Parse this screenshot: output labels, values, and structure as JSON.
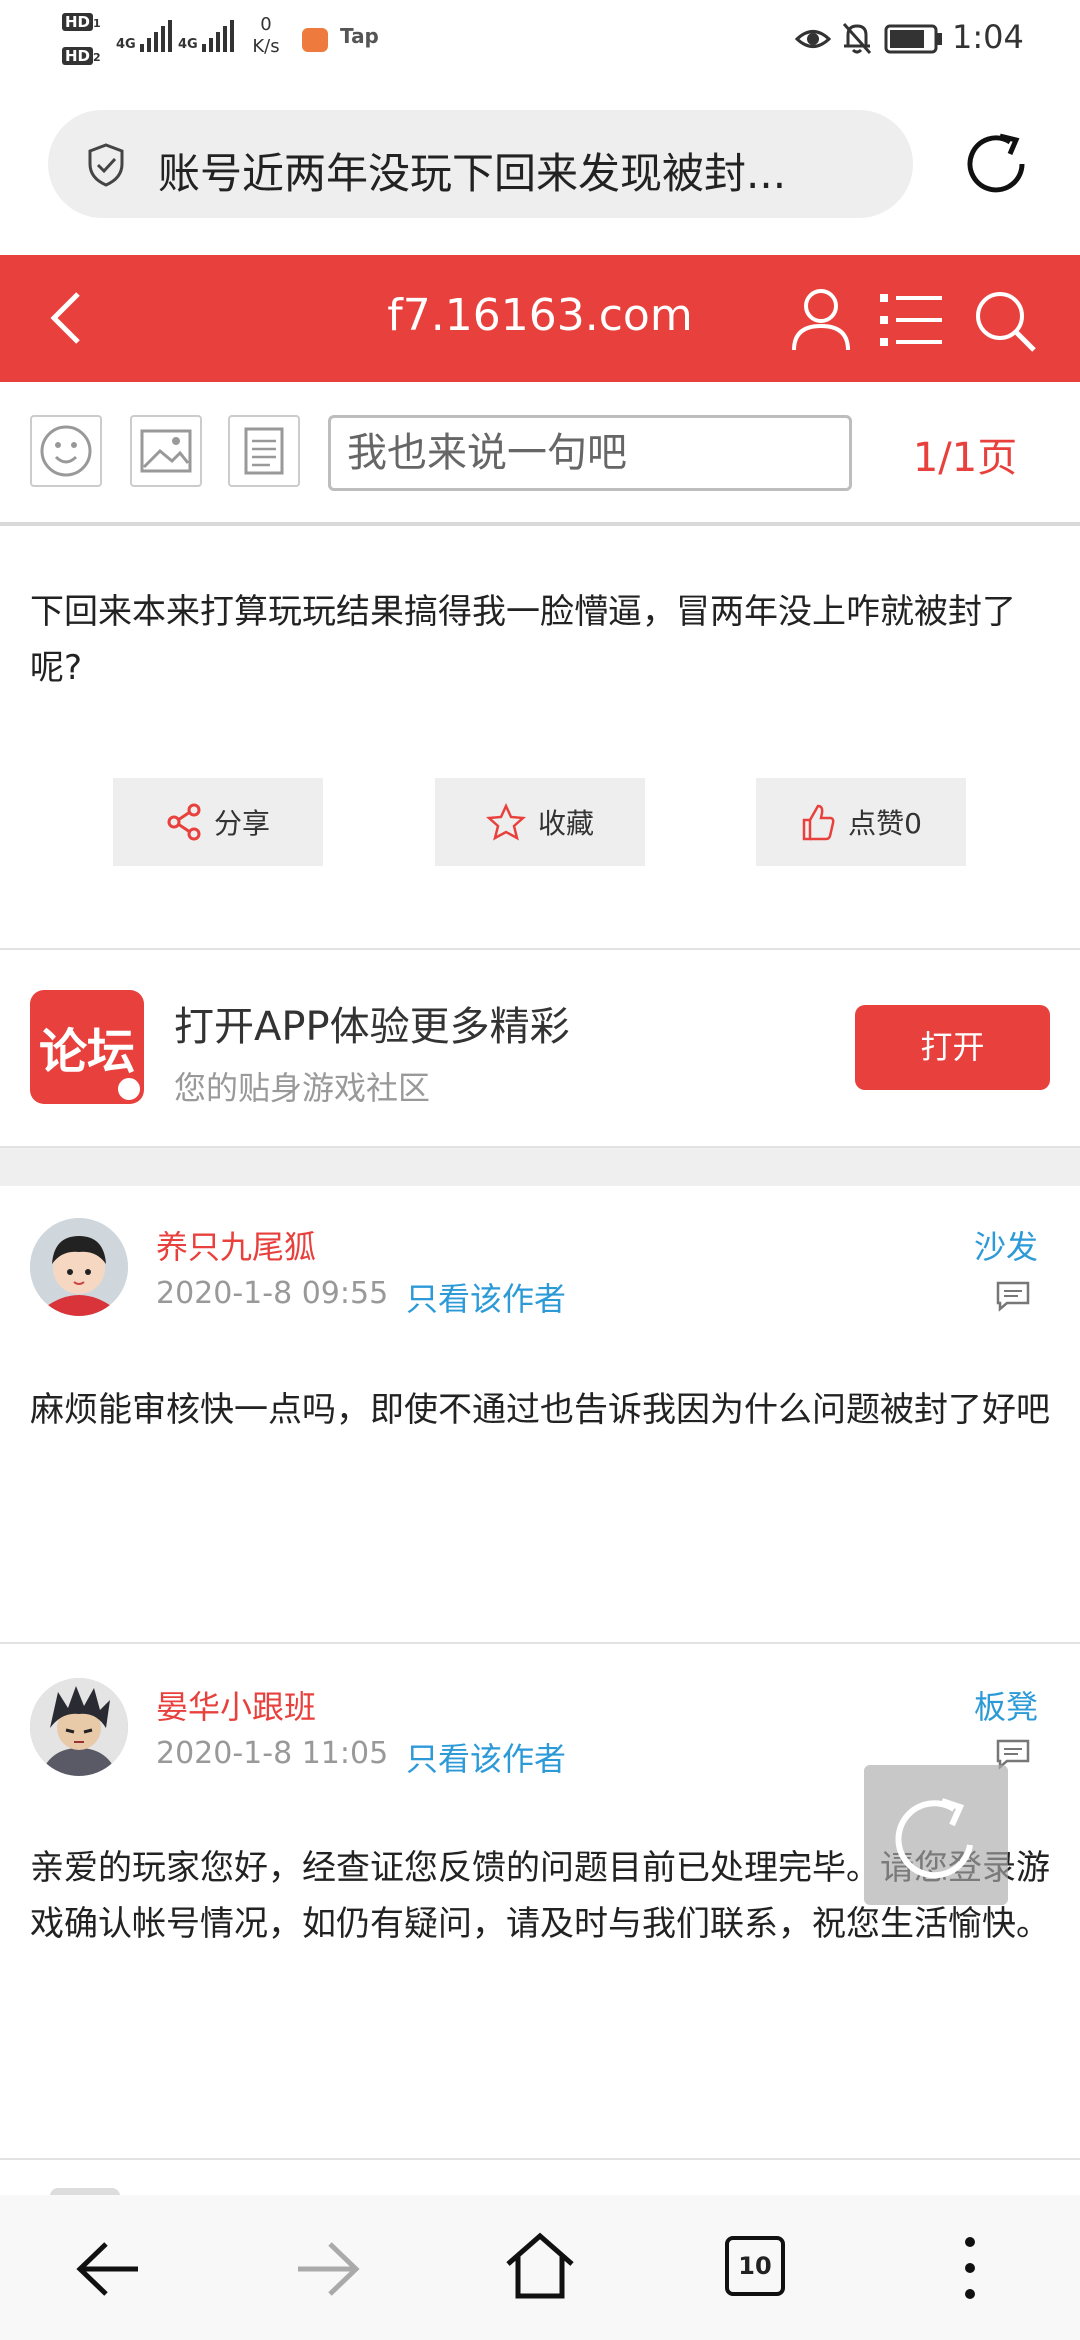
{
  "status_bar": {
    "hd1": "HD",
    "hd1_sub": "1",
    "hd2": "HD",
    "hd2_sub": "2",
    "network1": "4G",
    "network2": "4G",
    "net_speed_value": "0",
    "net_speed_unit": "K/s",
    "app_label": "Tap",
    "time": "1:04"
  },
  "address_bar": {
    "title": "账号近两年没玩下回来发现被封..."
  },
  "header": {
    "domain": "f7.16163.com"
  },
  "toolbar": {
    "reply_placeholder": "我也来说一句吧",
    "pager": "1/1页"
  },
  "main_post": {
    "text": "下回来本来打算玩玩结果搞得我一脸懵逼，冒两年没上咋就被封了呢?",
    "actions": {
      "share": "分享",
      "favorite": "收藏",
      "like": "点赞0"
    }
  },
  "app_banner": {
    "logo_text": "论坛",
    "title": "打开APP体验更多精彩",
    "subtitle": "您的贴身游戏社区",
    "open_button": "打开"
  },
  "replies": [
    {
      "username": "养只九尾狐",
      "date": "2020-1-8 09:55",
      "only_author": "只看该作者",
      "floor": "沙发",
      "text": "麻烦能审核快一点吗，即使不通过也告诉我因为什么问题被封了好吧"
    },
    {
      "username": "晏华小跟班",
      "date": "2020-1-8 11:05",
      "only_author": "只看该作者",
      "floor": "板凳",
      "text": "亲爱的玩家您好，经查证您反馈的问题目前已处理完毕。请您登录游戏确认帐号情况，如仍有疑问，请及时与我们联系，祝您生活愉快。"
    }
  ],
  "bottom_nav": {
    "tabs_count": "10"
  },
  "colors": {
    "brand_red": "#e8413d",
    "link_blue": "#2d9ad8",
    "muted_gray": "#999999"
  },
  "icons": {
    "address_bar": "shield-check-icon",
    "reload": "reload-icon",
    "back": "back-arrow-icon",
    "user": "user-icon",
    "menu": "list-menu-icon",
    "search": "search-icon",
    "emoji": "emoji-icon",
    "image": "image-icon",
    "document": "document-icon",
    "share": "share-icon",
    "favorite": "star-icon",
    "like": "thumbs-up-icon",
    "comment": "comment-icon"
  }
}
